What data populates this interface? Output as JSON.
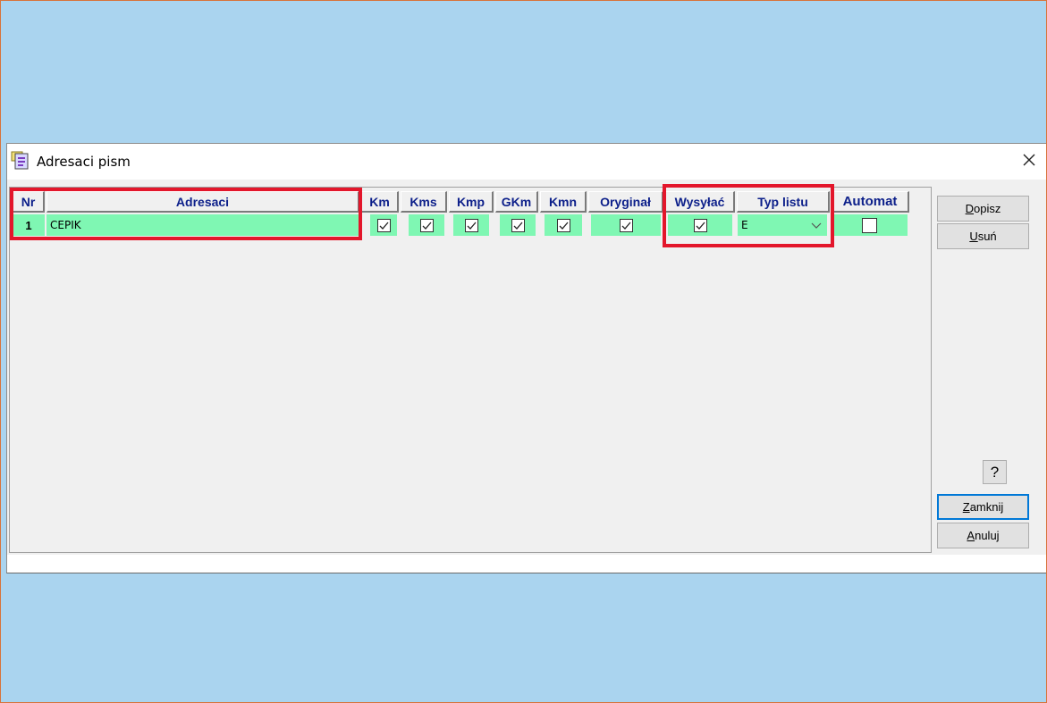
{
  "window": {
    "title": "Adresaci pism",
    "close_glyph": "✕"
  },
  "grid": {
    "columns": [
      "Nr",
      "Adresaci",
      "Km",
      "Kms",
      "Kmp",
      "GKm",
      "Kmn",
      "Oryginał",
      "Wysyłać",
      "Typ listu",
      "Automat"
    ],
    "rows": [
      {
        "nr": "1",
        "adresaci": "CEPIK",
        "km": true,
        "kms": true,
        "kmp": true,
        "gkm": true,
        "kmn": true,
        "oryginal": true,
        "wysylac": true,
        "typ_listu": "E",
        "automat": false
      }
    ]
  },
  "buttons": {
    "dopisz": {
      "key": "D",
      "rest": "opisz"
    },
    "usun": {
      "key": "U",
      "rest": "suń"
    },
    "help": "?",
    "zamknij": {
      "key": "Z",
      "rest": "amknij"
    },
    "anuluj": {
      "key": "A",
      "rest": "nuluj"
    }
  },
  "colors": {
    "desktop": "#aad4ef",
    "row_highlight": "#7ff7b3",
    "header_text": "#0c1f8a",
    "annotation_red": "#e3162b"
  },
  "icons": [
    "app-icon",
    "close-icon",
    "checkbox-checked-icon",
    "checkbox-empty-icon",
    "chevron-down-icon"
  ]
}
